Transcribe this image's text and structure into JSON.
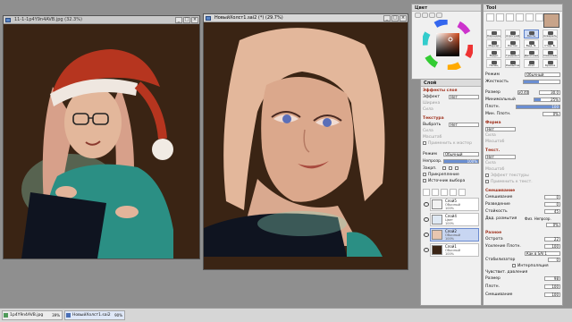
{
  "canvas1": {
    "title": "11-1-1p4Y9n4AVB.jpg (32.3%)",
    "buttons": [
      "_",
      "□",
      "×"
    ]
  },
  "canvas2": {
    "title": "НовыйХолст1.sai2 (*) (29.7%)",
    "buttons": [
      "_",
      "□",
      "×"
    ]
  },
  "color_panel": {
    "title": "Цвет"
  },
  "tool_panel": {
    "title": "Tool",
    "tools": [
      "Карандаш",
      "Аэрограф",
      "Кисть",
      "Акварель",
      "Маркер",
      "Ластик",
      "Выд. Б.",
      "Стир. Б.",
      "Ведро",
      "Градиент",
      "Двоичный",
      "Смешивание",
      "Палец",
      "Размытие",
      "Лонг",
      "Краска"
    ],
    "active_tool": "Кисть",
    "primary_color": "#c8a48a",
    "mode_label": "Режим",
    "mode_value": "Обычный",
    "hardness_label": "Жесткость",
    "size_label": "Размер",
    "size_mult": "x0.40",
    "size_value": "30.0",
    "min_size_label": "Минимальный",
    "min_size_value": "25%",
    "density_label": "Плотн.",
    "density_value": "100",
    "min_density_label": "Мин. Плотн.",
    "min_density_value": "0%",
    "shape_section": "Форма",
    "shape_value": "Нет",
    "shape_props": [
      "Сила",
      "Масштаб"
    ],
    "texture_section": "Текст.",
    "texture_value": "Нет",
    "texture_props": [
      "Сила",
      "Масштаб"
    ],
    "texture_check": "Эффект текстуры",
    "texture_check2": "Применить к текст.",
    "mixing_section": "Смешивание",
    "mixing_rows": [
      {
        "label": "Смешивание",
        "value": "0"
      },
      {
        "label": "Разведение",
        "value": "0"
      },
      {
        "label": "Стойкость",
        "value": "45"
      }
    ],
    "blur_label": "Двд. размытия",
    "blur_value": "Физ. Непрозр.",
    "blur_pct": "0%",
    "extra_section": "Разное",
    "extra_rows": [
      {
        "label": "Острота",
        "value": "22"
      },
      {
        "label": "Усиление Плотн.",
        "value": "100"
      }
    ],
    "smoothing_label": "Как в SAI 1",
    "stabilizer_label": "Стабилизатор",
    "stabilizer_value": "0",
    "interp_label": "Интерполяция",
    "pressure_label": "Чувствит. давления",
    "pressure_rows": [
      {
        "label": "Размер",
        "value": "98"
      },
      {
        "label": "Плотн.",
        "value": "100"
      },
      {
        "label": "Смешивание",
        "value": "100"
      }
    ],
    "hardness_fraction": 0.42,
    "min_size_fraction": 0.25,
    "density_fraction": 1.0
  },
  "layer_panel": {
    "title": "Слой",
    "effects_section": "Эффекты слоя",
    "effect_label": "Эффект",
    "effect_value": "Нет",
    "effect_props": [
      "Ширина",
      "Сила"
    ],
    "texture_section": "Текстура",
    "texture_label": "Выбрать",
    "texture_value": "Нет",
    "texture_props": [
      "Сила",
      "Масштаб"
    ],
    "texture_check": "Применить к мастер",
    "mode_label": "Режим",
    "mode_value": "Обычный",
    "opacity_label": "Непрозр.",
    "opacity_value": "100%",
    "opacity_fraction": 1.0,
    "lock_label": "Закрп.",
    "clip_label": "Прикрепление",
    "source_label": "Источник выбора",
    "layers": [
      {
        "name": "Слой5",
        "mode": "Обычный",
        "opacity": "100%",
        "thumb": "#f2f2f2"
      },
      {
        "name": "Слой4",
        "mode": "Цвет",
        "opacity": "100%",
        "thumb": "#dfe9f4"
      },
      {
        "name": "Слой2",
        "mode": "Обычный",
        "opacity": "100%",
        "thumb": "#e7c6b0",
        "active": true
      },
      {
        "name": "Слой1",
        "mode": "Обычный",
        "opacity": "100%",
        "thumb": "#3b2516"
      }
    ]
  },
  "taskbar": {
    "items": [
      {
        "label": "1p4Y9n4AVB.jpg",
        "pct": "39%"
      },
      {
        "label": "НовыйХолст1.sai2",
        "pct": "90%"
      }
    ]
  },
  "colors": {
    "canvas_bg": "#3a2414",
    "hair": "#e3b79b",
    "skin": "#dba88c",
    "hat_red": "#b6351f",
    "sweater": "#2b8f84",
    "device": "#0f1420"
  }
}
